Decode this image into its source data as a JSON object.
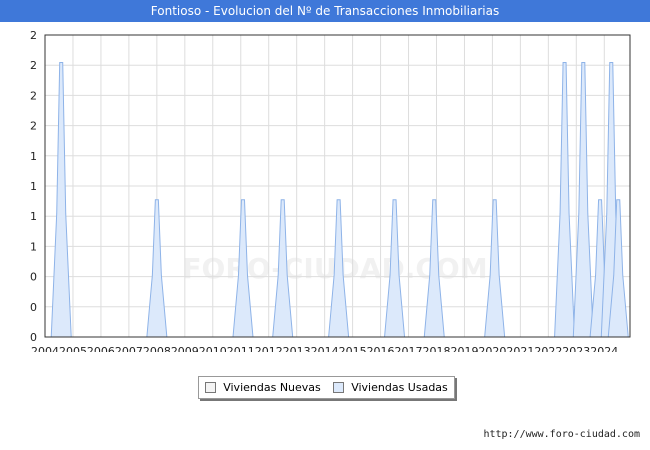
{
  "chart_title": "Fontioso - Evolucion del Nº de Transacciones Inmobiliarias",
  "credit": "http://www.foro-ciudad.com",
  "watermark": "FORO-CIUDAD.COM",
  "colors": {
    "title_bar": "#3f78d9",
    "nuevas_fill": "#f4f4f4",
    "usadas_fill": "#dce9fb",
    "usadas_line": "#8eb3e8",
    "grid": "#dddddd"
  },
  "chart_data": {
    "type": "area",
    "title": "Fontioso - Evolucion del Nº de Transacciones Inmobiliarias",
    "xlabel": "",
    "ylabel": "",
    "x_range": [
      2004,
      2024.92
    ],
    "ylim": [
      0,
      2.2
    ],
    "grid": true,
    "legend_position": "bottom-center",
    "x_tick_labels": [
      "2004",
      "2005",
      "2006",
      "2007",
      "2008",
      "2009",
      "2010",
      "2011",
      "2012",
      "2013",
      "2014",
      "2015",
      "2016",
      "2017",
      "2018",
      "2019",
      "2020",
      "2021",
      "2022",
      "2023",
      "2024"
    ],
    "y_tick_labels": [
      "0",
      "0",
      "0",
      "1",
      "1",
      "1",
      "1",
      "2",
      "2",
      "2",
      "2"
    ],
    "series": [
      {
        "name": "Viviendas Nuevas",
        "values": []
      },
      {
        "name": "Viviendas Usadas",
        "points": [
          {
            "x": 2004.58,
            "y": 2
          },
          {
            "x": 2008.0,
            "y": 1
          },
          {
            "x": 2011.08,
            "y": 1
          },
          {
            "x": 2012.5,
            "y": 1
          },
          {
            "x": 2014.5,
            "y": 1
          },
          {
            "x": 2016.5,
            "y": 1
          },
          {
            "x": 2017.92,
            "y": 1
          },
          {
            "x": 2020.08,
            "y": 1
          },
          {
            "x": 2022.58,
            "y": 2
          },
          {
            "x": 2023.25,
            "y": 2
          },
          {
            "x": 2023.85,
            "y": 1
          },
          {
            "x": 2024.25,
            "y": 2
          },
          {
            "x": 2024.5,
            "y": 1
          }
        ]
      }
    ]
  }
}
